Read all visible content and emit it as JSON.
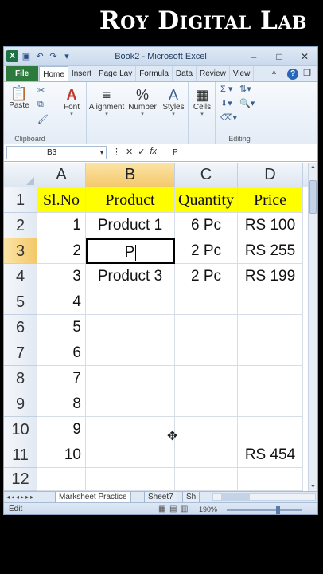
{
  "banner": {
    "title": "Roy Digital Lab"
  },
  "window": {
    "title": "Book2 - Microsoft Excel",
    "controls": {
      "minimize": "–",
      "maximize": "□",
      "close": "✕"
    }
  },
  "quick_access": {
    "logo": "X",
    "save": "💾",
    "undo": "↶",
    "redo": "↷"
  },
  "ribbon_tabs": [
    "File",
    "Home",
    "Insert",
    "Page Lay",
    "Formula",
    "Data",
    "Review",
    "View"
  ],
  "ribbon": {
    "clipboard": {
      "label": "Clipboard",
      "paste": "Paste"
    },
    "font": {
      "label": "Font"
    },
    "alignment": {
      "label": "Alignment"
    },
    "number": {
      "label": "Number"
    },
    "styles": {
      "label": "Styles"
    },
    "cells": {
      "label": "Cells"
    },
    "editing": {
      "label": "Editing"
    }
  },
  "formula_bar": {
    "name_box": "B3",
    "fx": "fx",
    "content": "P"
  },
  "grid": {
    "columns": [
      "A",
      "B",
      "C",
      "D"
    ],
    "selected_column": "B",
    "selected_row": "3",
    "rows": [
      {
        "num": "1",
        "a": "Sl.No",
        "b": "Product",
        "c": "Quantity",
        "d": "Price"
      },
      {
        "num": "2",
        "a": "1",
        "b": "Product 1",
        "c": "6 Pc",
        "d": "RS 100"
      },
      {
        "num": "3",
        "a": "2",
        "b": "P",
        "c": "2 Pc",
        "d": "RS 255"
      },
      {
        "num": "4",
        "a": "3",
        "b": "Product 3",
        "c": "2 Pc",
        "d": "RS 199"
      },
      {
        "num": "5",
        "a": "4",
        "b": "",
        "c": "",
        "d": ""
      },
      {
        "num": "6",
        "a": "5",
        "b": "",
        "c": "",
        "d": ""
      },
      {
        "num": "7",
        "a": "6",
        "b": "",
        "c": "",
        "d": ""
      },
      {
        "num": "8",
        "a": "7",
        "b": "",
        "c": "",
        "d": ""
      },
      {
        "num": "9",
        "a": "8",
        "b": "",
        "c": "",
        "d": ""
      },
      {
        "num": "10",
        "a": "9",
        "b": "",
        "c": "",
        "d": ""
      },
      {
        "num": "11",
        "a": "10",
        "b": "",
        "c": "",
        "d": "RS 454"
      },
      {
        "num": "12",
        "a": "",
        "b": "",
        "c": "",
        "d": ""
      }
    ]
  },
  "sheets": {
    "nav": "◂◂◂▸▸▸",
    "tabs": [
      "Marksheet Practice",
      "Sheet7",
      "Sh"
    ]
  },
  "status": {
    "mode": "Edit",
    "zoom": "190%"
  },
  "colors": {
    "header_fill": "#ffff00",
    "file_tab": "#2c7b3c",
    "selection": "#f4c86a"
  }
}
